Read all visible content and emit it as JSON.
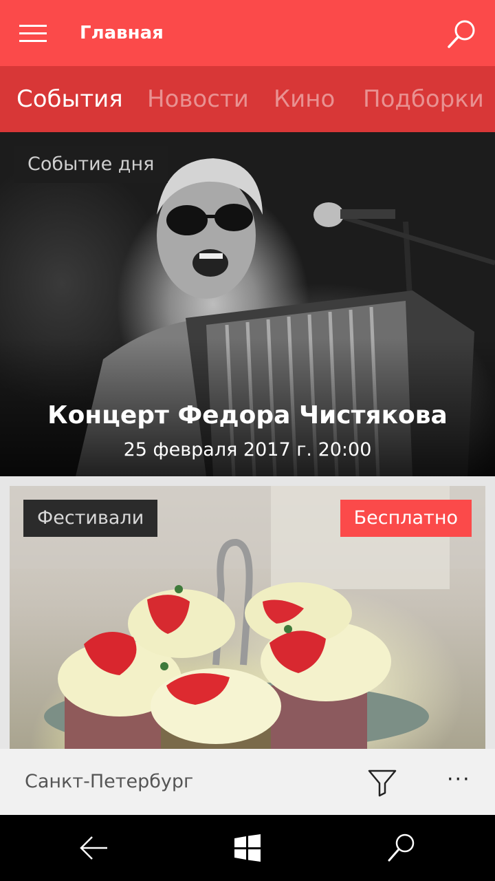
{
  "app_bar": {
    "title": "Главная",
    "menu_icon": "hamburger-menu-icon",
    "search_icon": "search-icon"
  },
  "tabs": [
    {
      "label": "События",
      "active": true
    },
    {
      "label": "Новости",
      "active": false
    },
    {
      "label": "Кино",
      "active": false
    },
    {
      "label": "Подборки",
      "active": false
    }
  ],
  "hero": {
    "tag": "Событие дня",
    "title": "Концерт Федора Чистякова",
    "datetime": "25 февраля 2017 г.  20:00",
    "image": "concert-photo"
  },
  "card": {
    "category": "Фестивали",
    "badge": "Бесплатно",
    "image": "cupcakes-photo"
  },
  "bottom_bar": {
    "city": "Санкт-Петербург",
    "filter_icon": "filter-icon",
    "more_label": "···"
  },
  "nav": {
    "back_icon": "back-arrow-icon",
    "home_icon": "windows-icon",
    "search_icon": "search-icon"
  },
  "colors": {
    "accent": "#fb4a4a",
    "tabs_bg": "#d83737",
    "badge": "#fb4a4a"
  }
}
